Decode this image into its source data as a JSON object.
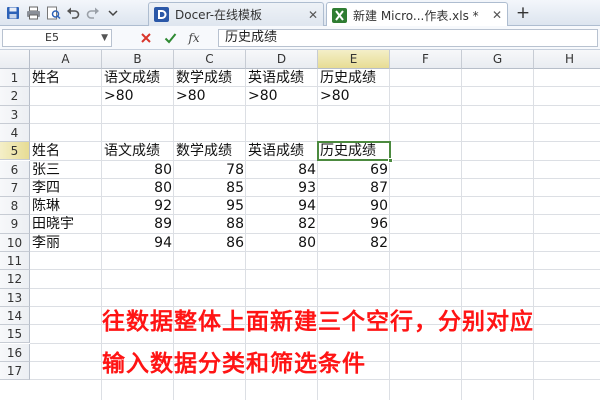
{
  "tabs": [
    {
      "label": "Docer-在线模板",
      "active": false
    },
    {
      "label": "新建 Micro...作表.xls *",
      "active": true
    }
  ],
  "formula_bar": {
    "cell_ref": "E5",
    "content": "历史成绩"
  },
  "columns": [
    "A",
    "B",
    "C",
    "D",
    "E",
    "F",
    "G",
    "H"
  ],
  "rows": [
    "1",
    "2",
    "3",
    "4",
    "5",
    "6",
    "7",
    "8",
    "9",
    "10",
    "11",
    "12",
    "13",
    "14",
    "15",
    "16",
    "17"
  ],
  "selected_cell": "E5",
  "cells": {
    "A1": "姓名",
    "B1": "语文成绩",
    "C1": "数学成绩",
    "D1": "英语成绩",
    "E1": "历史成绩",
    "B2": ">80",
    "C2": ">80",
    "D2": ">80",
    "E2": ">80",
    "A5": "姓名",
    "B5": "语文成绩",
    "C5": "数学成绩",
    "D5": "英语成绩",
    "E5": "历史成绩",
    "A6": " 张三",
    "B6": "80",
    "C6": "78",
    "D6": "84",
    "E6": "69",
    "A7": "李四",
    "B7": "80",
    "C7": "85",
    "D7": "93",
    "E7": "87",
    "A8": "陈琳",
    "B8": "92",
    "C8": "95",
    "D8": "94",
    "E8": "90",
    "A9": "田晓宇",
    "B9": "89",
    "C9": "88",
    "D9": "82",
    "E9": "96",
    "A10": "李丽",
    "B10": "94",
    "C10": "86",
    "D10": "80",
    "E10": "82"
  },
  "annotation": {
    "line1": "往数据整体上面新建三个空行，分别对应",
    "line2": "输入数据分类和筛选条件"
  },
  "icons": {
    "save": "save-icon",
    "print": "print-icon",
    "preview": "print-preview-icon",
    "undo": "undo-icon",
    "redo": "redo-icon",
    "more": "chevron-down-icon",
    "docer": "docer-icon",
    "excel": "excel-icon",
    "cancel": "cross-icon",
    "confirm": "check-icon",
    "function": "fx-icon"
  },
  "colors": {
    "accent_green": "#4c8a3f",
    "annotation_red": "#ff1414",
    "selected_header": "#e7dc94"
  }
}
